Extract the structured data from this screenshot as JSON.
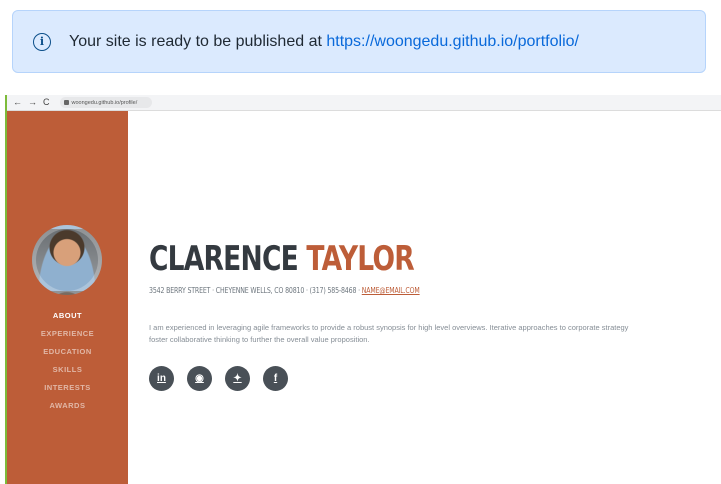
{
  "notice": {
    "text": "Your site is ready to be published at",
    "link": "https://woongedu.github.io/portfolio/"
  },
  "browser": {
    "nav_back": "←",
    "nav_forward": "→",
    "nav_reload": "C",
    "url": "woongedu.github.io/profile/"
  },
  "profile": {
    "first_name": "CLARENCE",
    "last_name": "TAYLOR",
    "address": "3542 BERRY STREET · CHEYENNE WELLS, CO 80810 · (317) 585-8468 ·",
    "email": "NAME@EMAIL.COM",
    "bio": "I am experienced in leveraging agile frameworks to provide a robust synopsis for high level overviews. Iterative approaches to corporate strategy foster collaborative thinking to further the overall value proposition.",
    "accent_color": "#bd5d38"
  },
  "nav": {
    "items": [
      {
        "label": "ABOUT"
      },
      {
        "label": "EXPERIENCE"
      },
      {
        "label": "EDUCATION"
      },
      {
        "label": "SKILLS"
      },
      {
        "label": "INTERESTS"
      },
      {
        "label": "AWARDS"
      }
    ]
  },
  "social": {
    "linkedin": "in",
    "github": "◉",
    "twitter": "✦",
    "facebook": "f"
  }
}
